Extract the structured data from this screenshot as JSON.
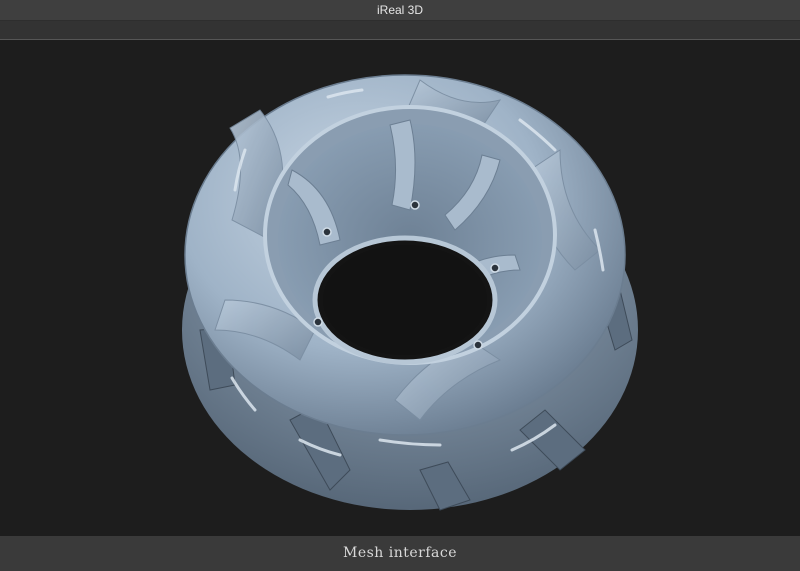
{
  "window": {
    "title": "iReal 3D"
  },
  "viewport": {
    "model": "impeller-mesh",
    "mesh_color": "#9fb6cc",
    "background": "#1d1d1d"
  },
  "status": {
    "caption": "Mesh interface"
  }
}
